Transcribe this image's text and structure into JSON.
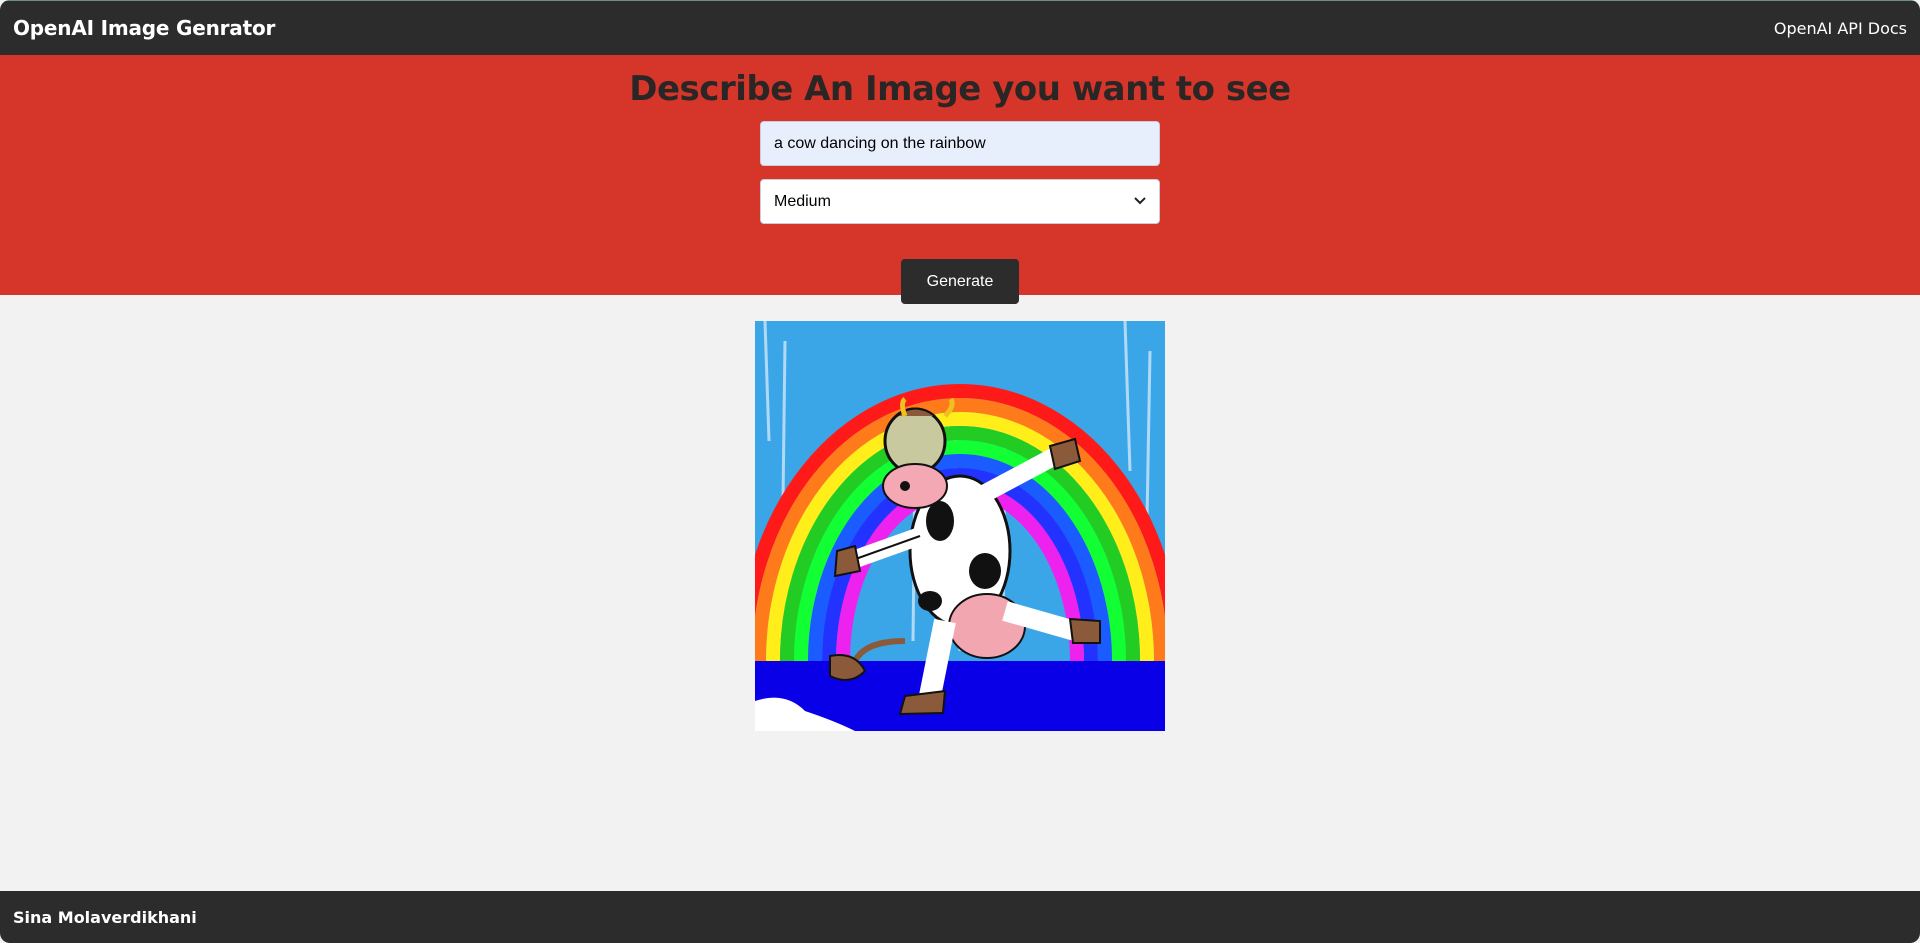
{
  "navbar": {
    "brand": "OpenAI Image Genrator",
    "docs_link": "OpenAI API Docs"
  },
  "hero": {
    "title": "Describe An Image you want to see"
  },
  "form": {
    "prompt_value": "a cow dancing on the rainbow",
    "size_selected": "Medium",
    "generate_label": "Generate"
  },
  "result": {
    "icon": "generated-image"
  },
  "footer": {
    "author": "Sina Molaverdikhani"
  },
  "colors": {
    "navbar_bg": "#2c2c2c",
    "hero_bg": "#d63629",
    "page_bg": "#f2f2f2",
    "button_bg": "#2c2c2c"
  }
}
